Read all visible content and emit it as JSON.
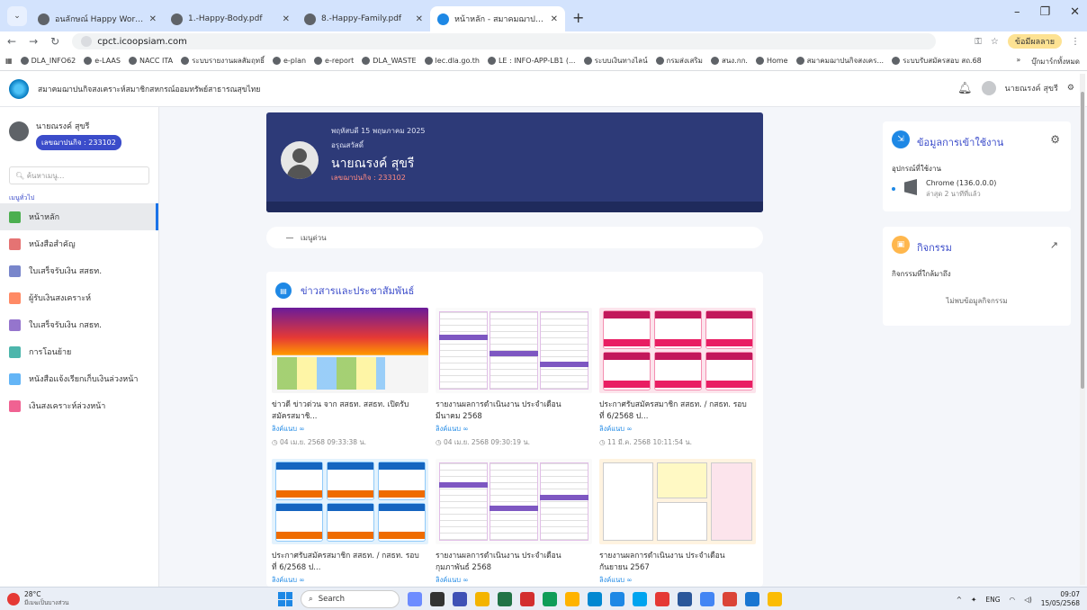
{
  "browser": {
    "tabs": [
      {
        "label": "อนลักษณ์ Happy Workplac",
        "active": false
      },
      {
        "label": "1.-Happy-Body.pdf",
        "active": false
      },
      {
        "label": "8.-Happy-Family.pdf",
        "active": false
      },
      {
        "label": "หน้าหลัก - สมาคมฌาปนกิจสงเคราะ",
        "active": true
      }
    ],
    "url": "cpct.icoopsiam.com",
    "profile_label": "ข้อมีผลลาย",
    "bookmarks": [
      "DLA_INFO62",
      "e-LAAS",
      "NACC ITA",
      "ระบบรายงานผลสัมฤทธิ์",
      "e-plan",
      "e-report",
      "DLA_WASTE",
      "lec.dla.go.th",
      "LE : INFO-APP-LB1 (...",
      "ระบบเงินทางไลน์",
      "กรมส่งเสริม",
      "สนง.กก.",
      "Home",
      "สมาคมฌาปนกิจสงเคร...",
      "ระบบรับสมัครสอบ สถ.68"
    ],
    "bookmarks_folder": "บุ๊กมาร์กทั้งหมด"
  },
  "header": {
    "title": "สมาคมฌาปนกิจสงเคราะห์สมาชิกสหกรณ์ออมทรัพย์สาธารณสุขไทย",
    "user": "นายณรงค์ สุขรี"
  },
  "sidebar": {
    "user_name": "นายณรงค์ สุขรี",
    "member_badge": "เลขฌาปนกิจ : 233102",
    "search_placeholder": "ค้นหาเมนู...",
    "section_label": "เมนูทั่วไป",
    "items": [
      {
        "label": "หน้าหลัก",
        "active": true,
        "color": "#4caf50"
      },
      {
        "label": "หนังสือสำคัญ",
        "active": false,
        "color": "#e57373"
      },
      {
        "label": "ใบเสร็จรับเงิน สสธท.",
        "active": false,
        "color": "#7986cb"
      },
      {
        "label": "ผู้รับเงินสงเคราะห์",
        "active": false,
        "color": "#ff8a65"
      },
      {
        "label": "ใบเสร็จรับเงิน กสธท.",
        "active": false,
        "color": "#9575cd"
      },
      {
        "label": "การโอนย้าย",
        "active": false,
        "color": "#4db6ac"
      },
      {
        "label": "หนังสือแจ้งเรียกเก็บเงินล่วงหน้า",
        "active": false,
        "color": "#64b5f6"
      },
      {
        "label": "เงินสงเคราะห์ล่วงหน้า",
        "active": false,
        "color": "#f06292"
      }
    ]
  },
  "profile": {
    "date": "พฤหัสบดี 15 พฤษภาคม 2025",
    "greeting": "อรุณสวัสดิ์",
    "name": "นายณรงค์ สุขรี",
    "member_id": "เลขฌาปนกิจ : 233102"
  },
  "quick_menu": {
    "label": "เมนูด่วน"
  },
  "news": {
    "title": "ข่าวสารและประชาสัมพันธ์",
    "items": [
      {
        "caption1": "ข่าวดี ข่าวด่วน จาก สสธท. สสธท. เปิดรับ",
        "caption2": "สมัครสมาชิ...",
        "link": "ลิงค์แนบ ∞",
        "date": "04 เม.ย. 2568 09:33:38 น."
      },
      {
        "caption1": "รายงานผลการดำเนินงาน ประจำเดือน",
        "caption2": "มีนาคม 2568",
        "link": "ลิงค์แนบ ∞",
        "date": "04 เม.ย. 2568 09:30:19 น."
      },
      {
        "caption1": "ประกาศรับสมัครสมาชิก สสธท. / กสธท. รอบ",
        "caption2": "ที่ 6/2568 ป...",
        "link": "ลิงค์แนบ ∞",
        "date": "11 มี.ค. 2568 10:11:54 น."
      },
      {
        "caption1": "ประกาศรับสมัครสมาชิก สสธท. / กสธท. รอบ",
        "caption2": "ที่ 6/2568 ป...",
        "link": "ลิงค์แนบ ∞",
        "date": ""
      },
      {
        "caption1": "รายงานผลการดำเนินงาน ประจำเดือน",
        "caption2": "กุมภาพันธ์ 2568",
        "link": "ลิงค์แนบ ∞",
        "date": ""
      },
      {
        "caption1": "รายงานผลการดำเนินงาน ประจำเดือน",
        "caption2": "กันยายน 2567",
        "link": "ลิงค์แนบ ∞",
        "date": ""
      }
    ]
  },
  "access_panel": {
    "title": "ข้อมูลการเข้าใช้งาน",
    "device_heading": "อุปกรณ์ที่ใช้งาน",
    "device_name": "Chrome (136.0.0.0)",
    "device_time": "ล่าสุด 2 นาทีที่แล้ว"
  },
  "activity_panel": {
    "title": "กิจกรรม",
    "subtitle": "กิจกรรมที่ใกล้มาถึง",
    "empty": "ไม่พบข้อมูลกิจกรรม"
  },
  "taskbar": {
    "temp": "28°C",
    "weather": "มีเมฆเป็นบางส่วน",
    "search": "Search",
    "lang": "ENG",
    "time": "09:07",
    "date": "15/05/2568"
  }
}
